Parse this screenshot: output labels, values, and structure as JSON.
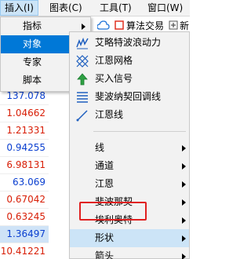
{
  "menubar": {
    "items": [
      {
        "label": "插入(I)"
      },
      {
        "label": "图表(C)"
      },
      {
        "label": "工具(T)"
      },
      {
        "label": "窗口(W)"
      }
    ]
  },
  "toolbar": {
    "algo_label": "算法交易",
    "new_label": "新"
  },
  "insert_menu": {
    "items": [
      {
        "label": "指标"
      },
      {
        "label": "对象"
      },
      {
        "label": "专家"
      },
      {
        "label": "脚本"
      }
    ]
  },
  "object_menu": {
    "tool_items": [
      {
        "label": "艾略特波浪动力",
        "icon": "elliott-wave-icon"
      },
      {
        "label": "江恩网格",
        "icon": "gann-grid-icon"
      },
      {
        "label": "买入信号",
        "icon": "buy-signal-icon"
      },
      {
        "label": "斐波纳契回调线",
        "icon": "fibonacci-icon"
      },
      {
        "label": "江恩线",
        "icon": "gann-line-icon"
      }
    ],
    "group_items": [
      {
        "label": "线"
      },
      {
        "label": "通道"
      },
      {
        "label": "江恩"
      },
      {
        "label": "斐波那契"
      },
      {
        "label": "埃利奥特"
      },
      {
        "label": "形状"
      },
      {
        "label": "箭头"
      }
    ]
  },
  "prices": [
    "137.078",
    "1.04662",
    "1.21331",
    "0.94255",
    "6.98131",
    "63.069",
    "0.67042",
    "0.63245",
    "1.36497",
    "10.41221"
  ]
}
